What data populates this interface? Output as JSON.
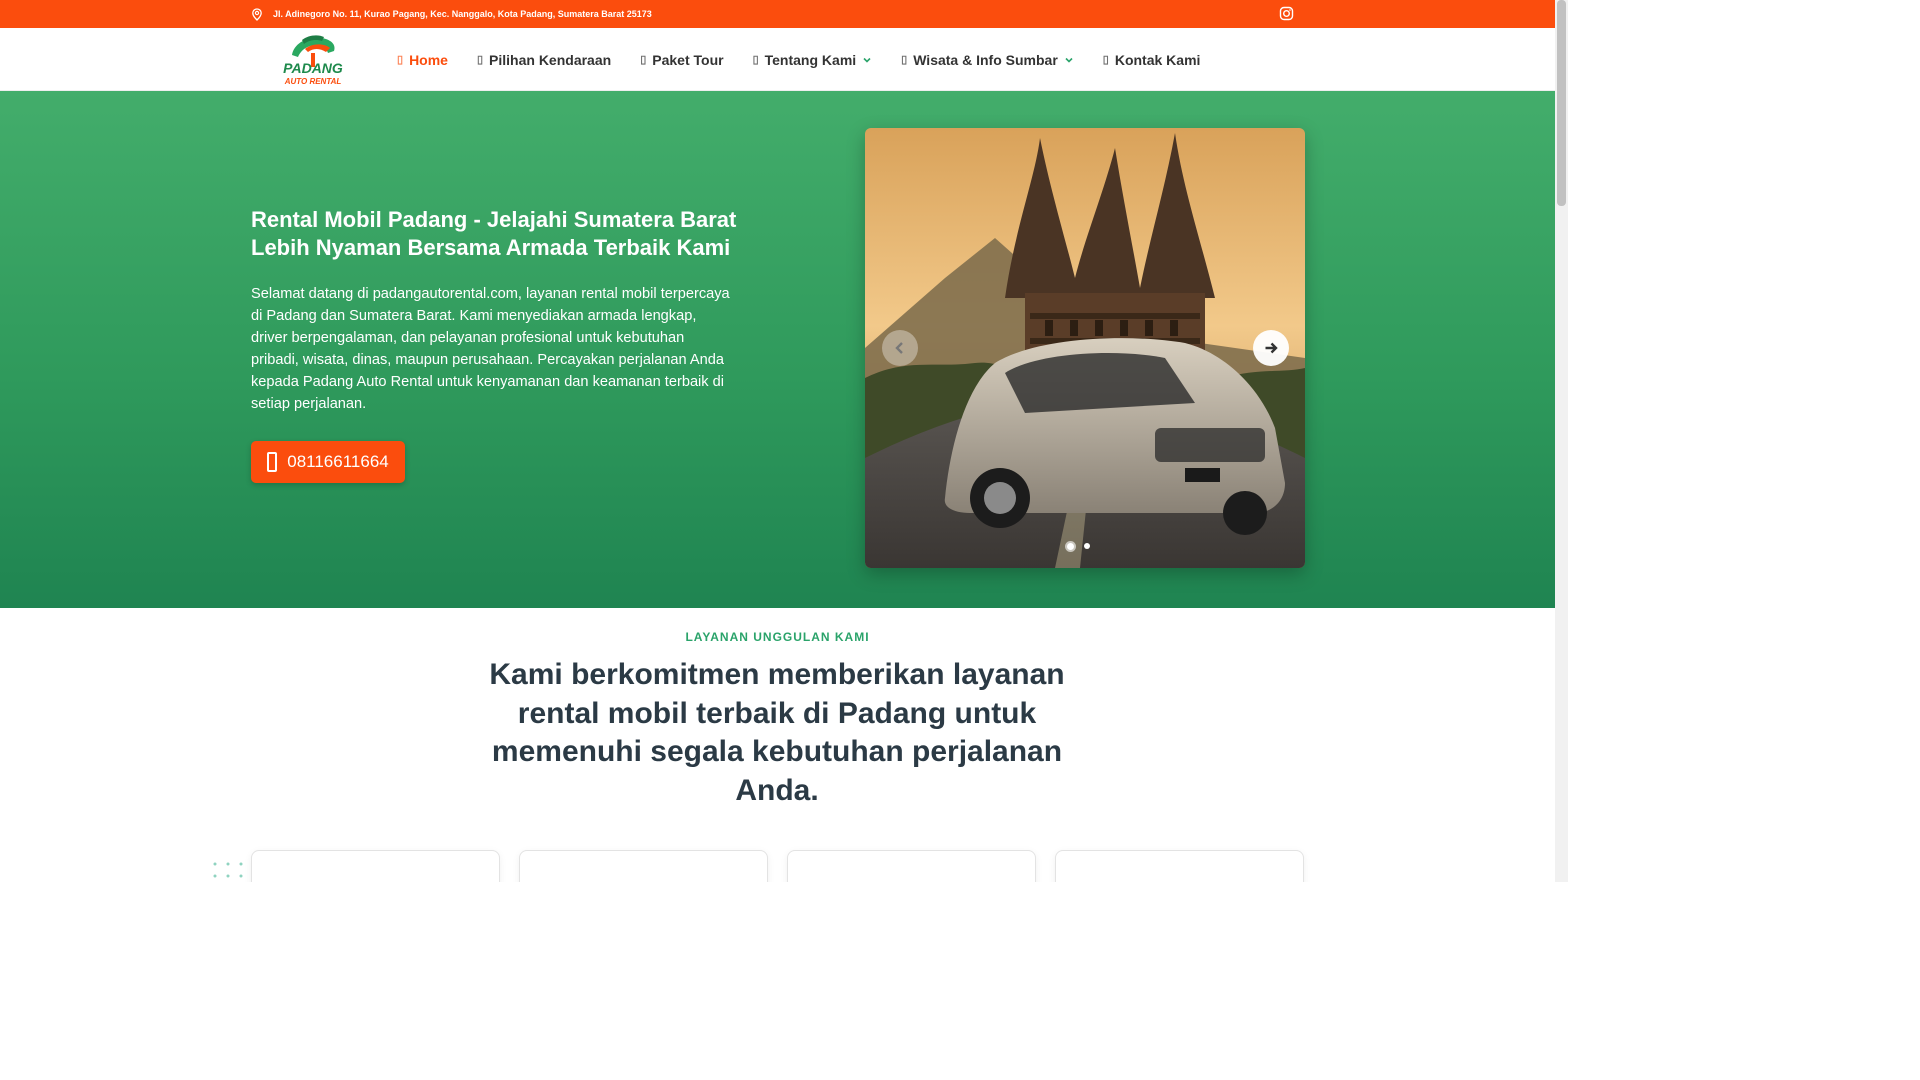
{
  "topbar": {
    "address": "Jl. Adinegoro No. 11, Kurao Pagang, Kec. Nanggalo, Kota Padang, Sumatera Barat 25173",
    "location_icon": "map-pin-icon",
    "social_icon": "instagram-icon"
  },
  "header": {
    "logo_text_1": "PADANG",
    "logo_text_2": "AUTO RENTAL",
    "nav": [
      {
        "label": "Home"
      },
      {
        "label": "Pilihan Kendaraan"
      },
      {
        "label": "Paket Tour"
      },
      {
        "label": "Tentang Kami"
      },
      {
        "label": "Wisata & Info Sumbar"
      },
      {
        "label": "Kontak Kami"
      }
    ]
  },
  "hero": {
    "title": "Rental Mobil Padang - Jelajahi Sumatera Barat Lebih Nyaman Bersama Armada Terbaik Kami",
    "text": "Selamat datang di padangautorental.com, layanan rental mobil terpercaya di Padang dan Sumatera Barat. Kami menyediakan armada lengkap, driver berpengalaman, dan pelayanan profesional untuk kebutuhan pribadi, wisata, dinas, maupun perusahaan. Percayakan perjalanan Anda kepada Padang Auto Rental untuk kenyamanan dan keamanan terbaik di setiap perjalanan.",
    "cta_label": "08116611664",
    "slider": {
      "current_slide": 1,
      "total_slides": 2
    }
  },
  "services": {
    "label": "LAYANAN UNGGULAN KAMI",
    "title": "Kami berkomitmen memberikan layanan rental mobil terbaik di Padang untuk memenuhi segala kebutuhan perjalanan Anda."
  },
  "colors": {
    "accent": "#fb4d0d",
    "green": "#2f9a5c",
    "label_green": "#2aa36a",
    "heading": "#2b3a45"
  }
}
